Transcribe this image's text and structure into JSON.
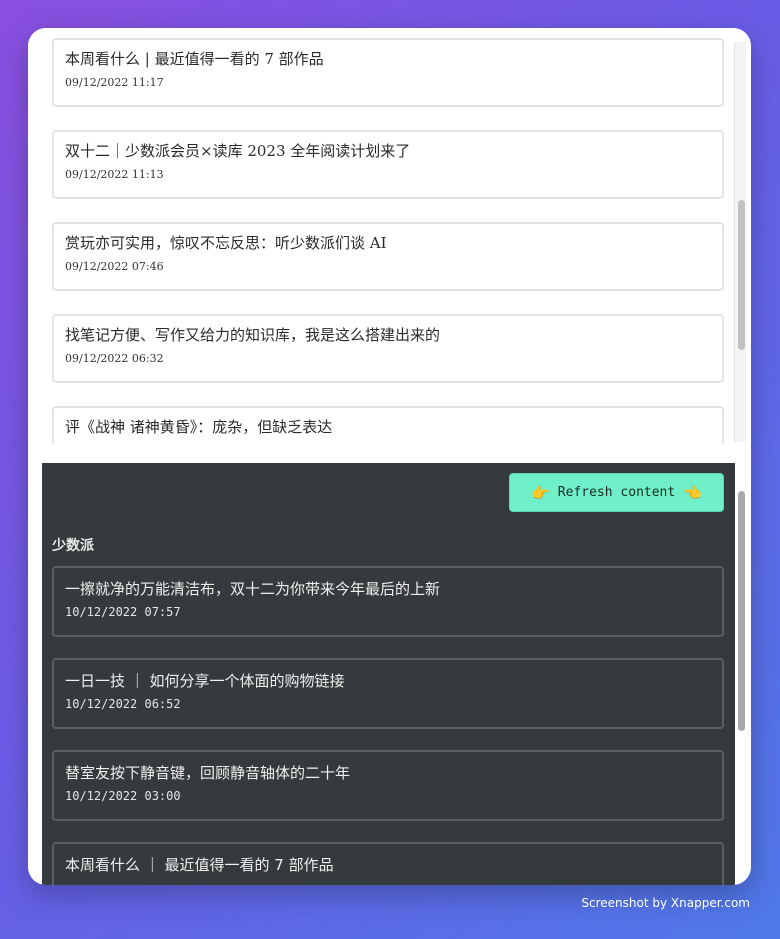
{
  "top_list": [
    {
      "title": "本周看什么 | 最近值得一看的 7 部作品",
      "time": "09/12/2022 11:17"
    },
    {
      "title": "双十二｜少数派会员×读库 2023 全年阅读计划来了",
      "time": "09/12/2022 11:13"
    },
    {
      "title": "赏玩亦可实用，惊叹不忘反思：听少数派们谈 AI",
      "time": "09/12/2022 07:46"
    },
    {
      "title": "找笔记方便、写作又给力的知识库，我是这么搭建出来的",
      "time": "09/12/2022 06:32"
    },
    {
      "title": "评《战神 诸神黄昏》：庞杂，但缺乏表达",
      "time": ""
    }
  ],
  "toolbar": {
    "hand_left": "👉",
    "refresh_label": "Refresh content",
    "hand_right": "👈"
  },
  "section": {
    "title": "少数派"
  },
  "bottom_list": [
    {
      "title": "一擦就净的万能清洁布，双十二为你带来今年最后的上新",
      "time": "10/12/2022 07:57"
    },
    {
      "title": "一日一技 ｜ 如何分享一个体面的购物链接",
      "time": "10/12/2022 06:52"
    },
    {
      "title": "替室友按下静音键，回顾静音轴体的二十年",
      "time": "10/12/2022 03:00"
    },
    {
      "title": "本周看什么 ｜ 最近值得一看的 7 部作品",
      "time": ""
    }
  ],
  "credit": "Screenshot by Xnapper.com",
  "colors": {
    "accent": "#6ff0c8",
    "dark_bg": "#353a3c",
    "gradient_start": "#8a4fe0",
    "gradient_end": "#4f78e8"
  }
}
